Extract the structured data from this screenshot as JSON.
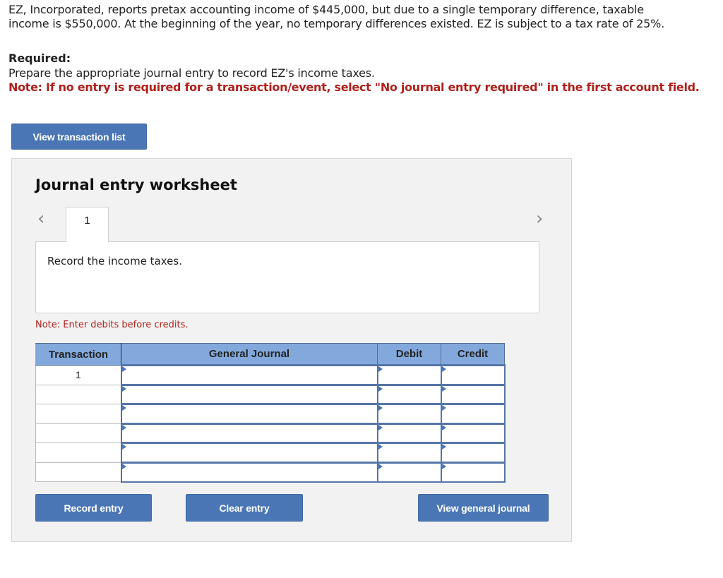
{
  "problem": {
    "line1": "EZ, Incorporated, reports pretax accounting income of $445,000, but due to a single temporary difference, taxable",
    "line2": "income is $550,000. At the beginning of the year, no temporary differences existed. EZ is subject to a tax rate of 25%."
  },
  "required": {
    "label": "Required:",
    "text": "Prepare the appropriate journal entry to record EZ's income taxes.",
    "note": "Note: If no entry is required for a transaction/event, select \"No journal entry required\" in the first account field."
  },
  "buttons": {
    "view_transaction_list": "View transaction list",
    "record_entry": "Record entry",
    "clear_entry": "Clear entry",
    "view_general_journal": "View general journal"
  },
  "worksheet": {
    "title": "Journal entry worksheet",
    "nav_prev": "‹",
    "nav_next": "›",
    "tabs": [
      {
        "label": "1",
        "active": true
      }
    ],
    "description": "Record the income taxes.",
    "note": "Note: Enter debits before credits.",
    "table": {
      "headers": [
        "Transaction",
        "General Journal",
        "Debit",
        "Credit"
      ],
      "rows": [
        {
          "transaction": "1",
          "account": "",
          "debit": "",
          "credit": ""
        },
        {
          "transaction": "",
          "account": "",
          "debit": "",
          "credit": ""
        },
        {
          "transaction": "",
          "account": "",
          "debit": "",
          "credit": ""
        },
        {
          "transaction": "",
          "account": "",
          "debit": "",
          "credit": ""
        },
        {
          "transaction": "",
          "account": "",
          "debit": "",
          "credit": ""
        },
        {
          "transaction": "",
          "account": "",
          "debit": "",
          "credit": ""
        }
      ]
    }
  },
  "colors": {
    "button": "#4a76b5",
    "table_header": "#83a9dc",
    "note_red": "#b0201b",
    "panel_bg": "#f2f2f2"
  }
}
